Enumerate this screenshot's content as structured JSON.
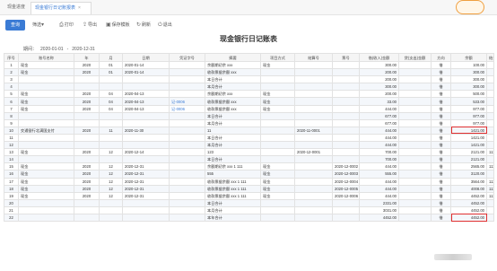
{
  "tabs": [
    "现金进度",
    "现金银行日记账报表"
  ],
  "toolbar": {
    "query": "查询",
    "filter": "筛选",
    "print": "打印",
    "export": "导出",
    "save_template": "保存模板",
    "refresh": "刷新",
    "exit": "退出"
  },
  "report": {
    "title": "现金银行日记账表",
    "period_label": "期间：",
    "period_from": "2020-01-01",
    "period_sep": "-",
    "period_to": "2020-12-31"
  },
  "columns": [
    "序号",
    "账号名称",
    "年",
    "月",
    "日期",
    "凭证字号",
    "摘要",
    "项目方式",
    "结算号",
    "票号",
    "借(收入)金额",
    "贷(支出)金额",
    "方向",
    "余额",
    "结余"
  ],
  "rows": [
    [
      "1",
      "现金",
      "2020",
      "01",
      "2020-01-14",
      "",
      "余额期初余 xxx",
      "现金",
      "",
      "",
      "300.00",
      "",
      "借",
      "100.00",
      ""
    ],
    [
      "2",
      "现金",
      "2020",
      "01",
      "2020-01-14",
      "",
      "收款票据余额 xxx",
      "",
      "",
      "",
      "200.00",
      "",
      "借",
      "300.00",
      ""
    ],
    [
      "3",
      "",
      "",
      "",
      "",
      "",
      "本日合计",
      "",
      "",
      "",
      "200.00",
      "",
      "借",
      "300.00",
      ""
    ],
    [
      "4",
      "",
      "",
      "",
      "",
      "",
      "本月合计",
      "",
      "",
      "",
      "300.00",
      "",
      "借",
      "300.00",
      ""
    ],
    [
      "5",
      "现金",
      "2020",
      "04",
      "2020-04-13",
      "",
      "余额期初余 xxx",
      "现金",
      "",
      "",
      "200.00",
      "",
      "借",
      "500.00",
      ""
    ],
    [
      "6",
      "现金",
      "2020",
      "04",
      "2020-04-13",
      "记-0006",
      "收款票据余额 xxx",
      "现金",
      "",
      "",
      "33.00",
      "",
      "借",
      "533.00",
      ""
    ],
    [
      "7",
      "现金",
      "2020",
      "04",
      "2020-04-13",
      "记-0006",
      "收款票据余额 xxx",
      "现金",
      "",
      "",
      "444.00",
      "",
      "借",
      "977.00",
      ""
    ],
    [
      "8",
      "",
      "",
      "",
      "",
      "",
      "本日合计",
      "",
      "",
      "",
      "677.00",
      "",
      "借",
      "977.00",
      ""
    ],
    [
      "9",
      "",
      "",
      "",
      "",
      "",
      "本月合计",
      "",
      "",
      "",
      "677.00",
      "",
      "借",
      "977.00",
      ""
    ],
    [
      "10",
      "交通银行北满国支付",
      "2020",
      "11",
      "2020-11-30",
      "",
      "11",
      "",
      "2020-11-0001",
      "",
      "444.00",
      "",
      "借",
      "1421.00",
      ""
    ],
    [
      "11",
      "",
      "",
      "",
      "",
      "",
      "本日合计",
      "",
      "",
      "",
      "444.00",
      "",
      "借",
      "1421.00",
      ""
    ],
    [
      "12",
      "",
      "",
      "",
      "",
      "",
      "本月合计",
      "",
      "",
      "",
      "444.00",
      "",
      "借",
      "1421.00",
      ""
    ],
    [
      "13",
      "现金",
      "2020",
      "12",
      "2020-12-14",
      "",
      "123",
      "",
      "2020-12-0001",
      "",
      "700.00",
      "",
      "借",
      "2121.00",
      "111"
    ],
    [
      "14",
      "",
      "",
      "",
      "",
      "",
      "本日合计",
      "",
      "",
      "",
      "700.00",
      "",
      "借",
      "2121.00",
      ""
    ],
    [
      "15",
      "现金",
      "2020",
      "12",
      "2020-12-31",
      "",
      "余额期初余 xxx 1 111",
      "现金",
      "",
      "2020-12-0002",
      "444.00",
      "",
      "借",
      "2565.00",
      "111"
    ],
    [
      "16",
      "现金",
      "2020",
      "12",
      "2020-12-31",
      "",
      "555",
      "现金",
      "",
      "2020-12-0003",
      "555.00",
      "",
      "借",
      "3120.00",
      ""
    ],
    [
      "17",
      "现金",
      "2020",
      "12",
      "2020-12-31",
      "",
      "收款票据余额 xxx 1 111",
      "现金",
      "",
      "2020-12-0004",
      "444.00",
      "",
      "借",
      "3564.00",
      "111"
    ],
    [
      "18",
      "现金",
      "2020",
      "12",
      "2020-12-31",
      "",
      "收款票据余额 xxx 1 111",
      "现金",
      "",
      "2020-12-0005",
      "444.00",
      "",
      "借",
      "4008.00",
      "111"
    ],
    [
      "19",
      "现金",
      "2020",
      "12",
      "2020-12-31",
      "",
      "收款票据余额 xxx 1 111",
      "现金",
      "",
      "2020-12-0006",
      "444.00",
      "",
      "借",
      "4452.00",
      "111"
    ],
    [
      "20",
      "",
      "",
      "",
      "",
      "",
      "本日合计",
      "",
      "",
      "",
      "2331.00",
      "",
      "借",
      "4452.00",
      ""
    ],
    [
      "21",
      "",
      "",
      "",
      "",
      "",
      "本月合计",
      "",
      "",
      "",
      "3031.00",
      "",
      "借",
      "4452.00",
      ""
    ],
    [
      "22",
      "",
      "",
      "",
      "",
      "",
      "本年合计",
      "",
      "",
      "",
      "4452.00",
      "",
      "借",
      "4452.00",
      ""
    ]
  ],
  "highlighted_balances": [
    "1421.00",
    "4452.00"
  ],
  "colors": {
    "accent": "#3a7bd5",
    "highlight_box": "#e03030"
  }
}
